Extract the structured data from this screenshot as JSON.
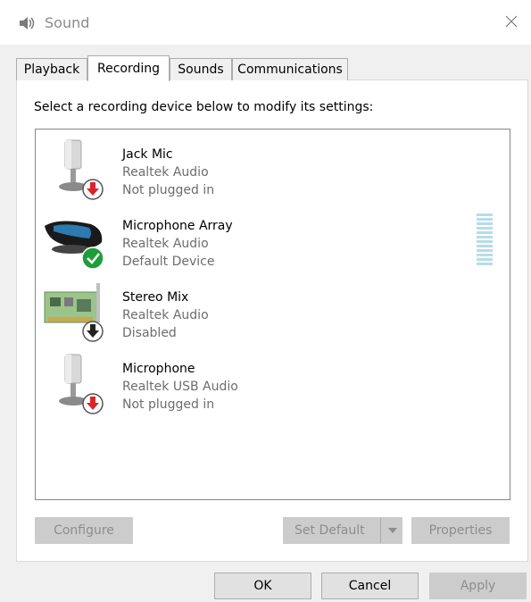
{
  "window": {
    "title": "Sound"
  },
  "tabs": [
    {
      "label": "Playback"
    },
    {
      "label": "Recording"
    },
    {
      "label": "Sounds"
    },
    {
      "label": "Communications"
    }
  ],
  "instructions": "Select a recording device below to modify its settings:",
  "devices": [
    {
      "name": "Jack Mic",
      "driver": "Realtek Audio",
      "status": "Not plugged in",
      "icon": "microphone-icon",
      "badge": "unplugged-red-arrow-icon"
    },
    {
      "name": "Microphone Array",
      "driver": "Realtek Audio",
      "status": "Default Device",
      "icon": "microphone-array-icon",
      "badge": "default-green-check-icon"
    },
    {
      "name": "Stereo Mix",
      "driver": "Realtek Audio",
      "status": "Disabled",
      "icon": "sound-card-icon",
      "badge": "disabled-black-arrow-icon"
    },
    {
      "name": "Microphone",
      "driver": "Realtek USB Audio",
      "status": "Not plugged in",
      "icon": "microphone-icon",
      "badge": "unplugged-red-arrow-icon"
    }
  ],
  "buttons": {
    "configure": "Configure",
    "set_default": "Set Default",
    "properties": "Properties",
    "ok": "OK",
    "cancel": "Cancel",
    "apply": "Apply"
  },
  "colors": {
    "level_meter": "#b7dce8",
    "badge_red": "#d9252a",
    "badge_green": "#1e9e3a"
  }
}
